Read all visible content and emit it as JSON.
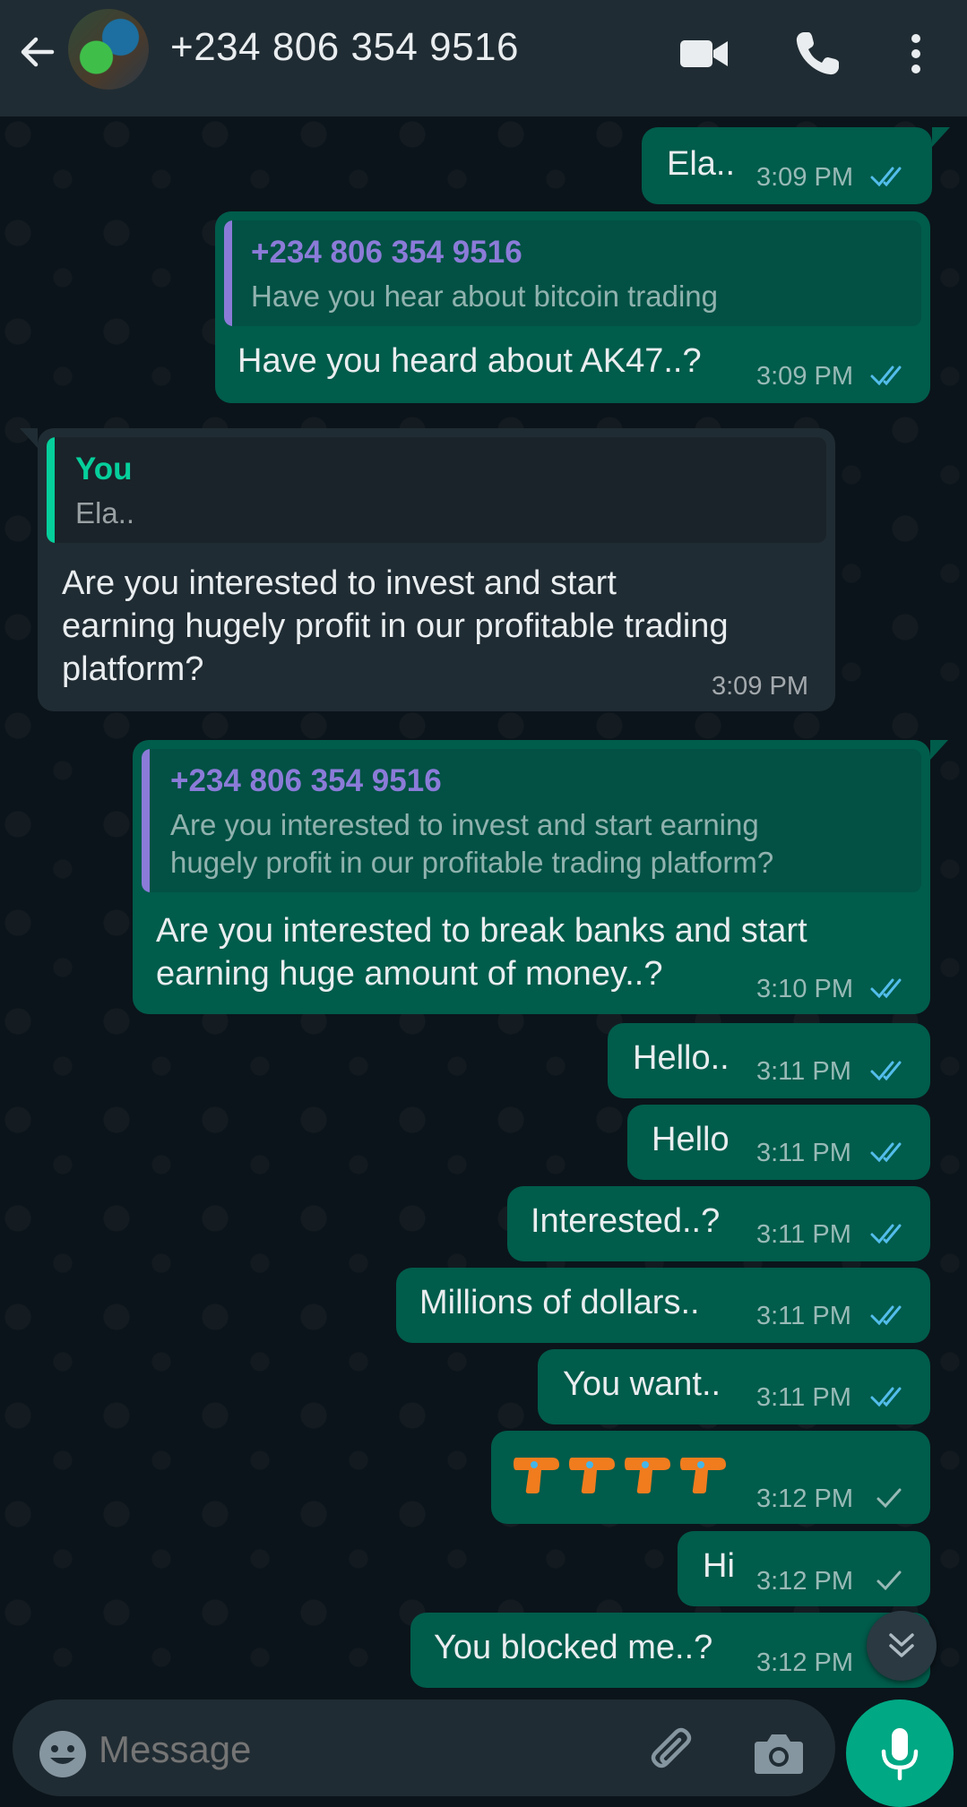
{
  "header": {
    "title": "+234 806 354 9516",
    "icons": [
      "back-arrow-icon",
      "contact-avatar",
      "video-call-icon",
      "voice-call-icon",
      "more-options-icon"
    ]
  },
  "messages": [
    {
      "dir": "out",
      "text": "Ela..",
      "time": "3:09 PM",
      "status": "read"
    },
    {
      "dir": "out",
      "quote_name": "+234 806 354 9516",
      "quote_text": "Have you hear about bitcoin trading",
      "text": "Have you heard about AK47..?",
      "time": "3:09 PM",
      "status": "read"
    },
    {
      "dir": "in",
      "quote_name": "You",
      "quote_text": "Ela..",
      "text_lines": [
        "Are you interested to invest and start",
        "earning hugely profit in our profitable trading",
        "platform?"
      ],
      "time": "3:09 PM"
    },
    {
      "dir": "out",
      "quote_name": "+234 806 354 9516",
      "quote_lines": [
        "Are you interested to invest and start earning",
        "hugely profit in our profitable trading platform?"
      ],
      "text_lines": [
        "Are you interested to break banks and start",
        "earning huge amount of money..?"
      ],
      "time": "3:10 PM",
      "status": "read"
    },
    {
      "dir": "out",
      "text": "Hello..",
      "time": "3:11 PM",
      "status": "read"
    },
    {
      "dir": "out",
      "text": "Hello",
      "time": "3:11 PM",
      "status": "read"
    },
    {
      "dir": "out",
      "text": "Interested..?",
      "time": "3:11 PM",
      "status": "read"
    },
    {
      "dir": "out",
      "text": "Millions of dollars..",
      "time": "3:11 PM",
      "status": "read"
    },
    {
      "dir": "out",
      "text": "You want..",
      "time": "3:11 PM",
      "status": "read"
    },
    {
      "dir": "out",
      "text": "🔫🔫🔫🔫",
      "time": "3:12 PM",
      "status": "sent"
    },
    {
      "dir": "out",
      "text": "Hi",
      "time": "3:12 PM",
      "status": "sent"
    },
    {
      "dir": "out",
      "text": "You blocked me..?",
      "time": "3:12 PM",
      "status": "sent"
    }
  ],
  "composer": {
    "placeholder": "Message",
    "icons": [
      "emoji-icon",
      "attach-icon",
      "camera-icon",
      "mic-icon"
    ]
  },
  "colors": {
    "background": "#0b141a",
    "header": "#202c33",
    "outgoing_bubble": "#005c4b",
    "incoming_bubble": "#202c33",
    "read_ticks": "#53bdeb",
    "quote_name_contact": "#8b7bd8",
    "quote_name_you": "#06cf9c",
    "accent": "#00a884"
  }
}
